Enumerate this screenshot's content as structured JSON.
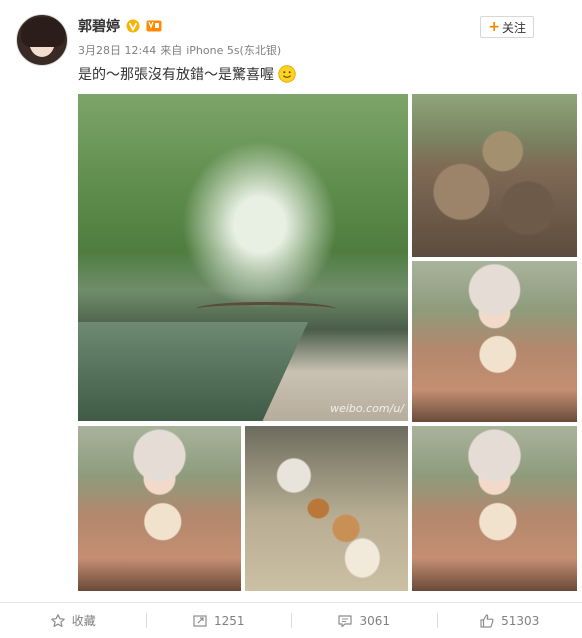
{
  "user": {
    "name": "郭碧婷",
    "follow_label": "关注"
  },
  "meta": {
    "time": "3月28日 12:44",
    "source_prefix": "来自",
    "source": "iPhone 5s(东北银)"
  },
  "post": {
    "text": "是的～那張沒有放錯～是驚喜喔"
  },
  "photos": {
    "watermark": "weibo.com/u/"
  },
  "actions": {
    "favorite_label": "收藏",
    "repost_count": "1251",
    "comment_count": "3061",
    "like_count": "51303"
  },
  "colors": {
    "accent": "#ff8200",
    "text_secondary": "#808080"
  }
}
